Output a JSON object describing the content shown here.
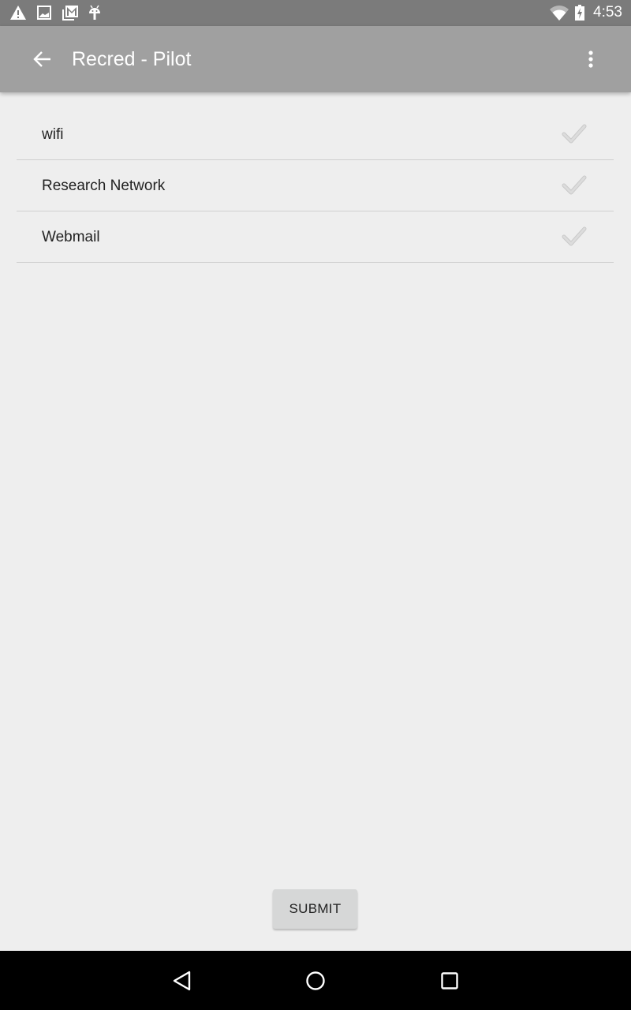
{
  "status_bar": {
    "notification_icons": [
      "warning-icon",
      "image-icon",
      "gmail-icon",
      "android-icon"
    ],
    "system_icons": [
      "wifi-icon",
      "battery-charging-icon"
    ],
    "time": "4:53"
  },
  "app_bar": {
    "back_icon": "arrow-back-icon",
    "title": "Recred - Pilot",
    "overflow_icon": "more-vert-icon"
  },
  "list": {
    "items": [
      {
        "label": "wifi",
        "checked_icon": "check-icon",
        "check_state": "unchecked"
      },
      {
        "label": "Research Network",
        "checked_icon": "check-icon",
        "check_state": "unchecked"
      },
      {
        "label": "Webmail",
        "checked_icon": "check-icon",
        "check_state": "unchecked"
      }
    ]
  },
  "submit_label": "SUBMIT",
  "nav_bar": {
    "buttons": [
      "back-triangle-icon",
      "home-circle-icon",
      "recents-square-icon"
    ]
  },
  "colors": {
    "status_bar": "#7b7b7b",
    "app_bar": "#a0a0a0",
    "background": "#eeeeee",
    "divider": "#cfcfcf",
    "check_inactive": "#d6d6d6",
    "button_bg": "#d6d7d7"
  }
}
